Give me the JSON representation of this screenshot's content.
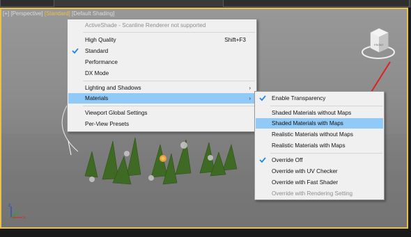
{
  "viewport": {
    "label_parts": [
      "[+]",
      "[Perspective]",
      "[Standard]",
      "[Default Shading]"
    ]
  },
  "menu": {
    "items": [
      {
        "label": "ActiveShade - Scanline Renderer not supported",
        "disabled": true
      },
      {
        "label": "High Quality",
        "shortcut": "Shift+F3"
      },
      {
        "label": "Standard",
        "checked": true
      },
      {
        "label": "Performance"
      },
      {
        "label": "DX Mode"
      },
      {
        "label": "Lighting and Shadows",
        "submenu": true
      },
      {
        "label": "Materials",
        "submenu": true,
        "highlighted": true
      },
      {
        "label": "Viewport Global Settings"
      },
      {
        "label": "Per-View Presets"
      }
    ]
  },
  "submenu": {
    "items": [
      {
        "label": "Enable Transparency",
        "checked": true
      },
      {
        "label": "Shaded Materials without Maps"
      },
      {
        "label": "Shaded Materials with Maps",
        "highlighted": true
      },
      {
        "label": "Realistic Materials without Maps"
      },
      {
        "label": "Realistic Materials with Maps"
      },
      {
        "label": "Override Off",
        "checked": true
      },
      {
        "label": "Override with UV Checker"
      },
      {
        "label": "Override with Fast Shader"
      },
      {
        "label": "Override with Rendering Setting",
        "disabled": true
      }
    ]
  },
  "viewcube": {
    "label": "FRONT"
  },
  "axis": {
    "x": "x",
    "y": "y",
    "z": "z"
  },
  "colors": {
    "viewport_border": "#e8c24a",
    "highlight": "#91c9f7",
    "check": "#1e88e5",
    "arrow": "#e02020"
  }
}
